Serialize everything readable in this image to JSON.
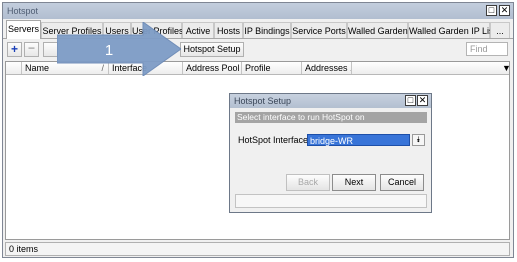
{
  "window": {
    "title": "Hotspot"
  },
  "tabs": [
    {
      "label": "Servers"
    },
    {
      "label": "Server Profiles"
    },
    {
      "label": "Users"
    },
    {
      "label": "User Profiles"
    },
    {
      "label": "Active"
    },
    {
      "label": "Hosts"
    },
    {
      "label": "IP Bindings"
    },
    {
      "label": "Service Ports"
    },
    {
      "label": "Walled Garden"
    },
    {
      "label": "Walled Garden IP List"
    },
    {
      "label": "..."
    }
  ],
  "toolbar": {
    "hotspot_setup_label": "Hotspot Setup",
    "find_placeholder": "Find"
  },
  "callout": {
    "step_number": "1",
    "color": "#7e9cc6"
  },
  "table": {
    "columns": [
      "Name",
      "Interface",
      "Address Pool",
      "Profile",
      "Addresses ..."
    ]
  },
  "status": {
    "items_count": "0 items"
  },
  "dialog": {
    "title": "Hotspot Setup",
    "info": "Select interface to run HotSpot on",
    "field_label": "HotSpot Interface:",
    "interface_value": "bridge-WR",
    "back_label": "Back",
    "next_label": "Next",
    "cancel_label": "Cancel"
  }
}
